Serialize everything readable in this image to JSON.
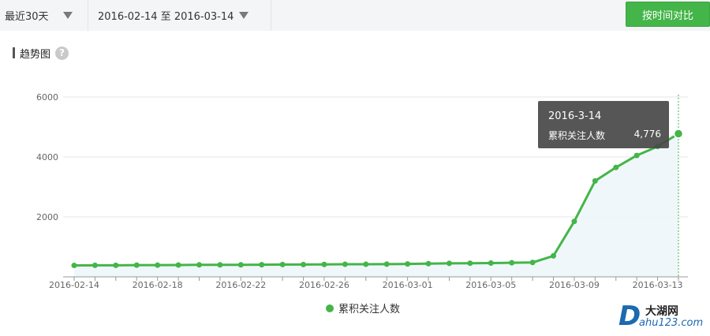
{
  "toolbar": {
    "period_label": "最近30天",
    "date_range_label": "2016-02-14 至 2016-03-14",
    "compare_button": "按时间对比"
  },
  "section": {
    "title": "趋势图",
    "help_icon": "?"
  },
  "tooltip": {
    "date": "2016-3-14",
    "series_name": "累积关注人数",
    "value_text": "4,776"
  },
  "legend": {
    "label": "累积关注人数"
  },
  "watermark": {
    "logo_letter": "D",
    "name": "大湖网",
    "url": "ahu123.com"
  },
  "colors": {
    "accent": "#44b549",
    "grid": "#e6e6e6",
    "axis": "#999999"
  },
  "chart_data": {
    "type": "line",
    "title": "",
    "xlabel": "",
    "ylabel": "",
    "ylim": [
      0,
      6000
    ],
    "yticks": [
      2000,
      4000,
      6000
    ],
    "x": [
      "2016-02-14",
      "2016-02-15",
      "2016-02-16",
      "2016-02-17",
      "2016-02-18",
      "2016-02-19",
      "2016-02-20",
      "2016-02-21",
      "2016-02-22",
      "2016-02-23",
      "2016-02-24",
      "2016-02-25",
      "2016-02-26",
      "2016-02-27",
      "2016-02-28",
      "2016-02-29",
      "2016-03-01",
      "2016-03-02",
      "2016-03-03",
      "2016-03-04",
      "2016-03-05",
      "2016-03-06",
      "2016-03-07",
      "2016-03-08",
      "2016-03-09",
      "2016-03-10",
      "2016-03-11",
      "2016-03-12",
      "2016-03-13",
      "2016-03-14"
    ],
    "xtick_labels": [
      "2016-02-14",
      "2016-02-18",
      "2016-02-22",
      "2016-02-26",
      "2016-03-01",
      "2016-03-05",
      "2016-03-09",
      "2016-03-13"
    ],
    "series": [
      {
        "name": "累积关注人数",
        "values": [
          380,
          385,
          385,
          390,
          390,
          395,
          400,
          400,
          400,
          405,
          410,
          410,
          415,
          420,
          420,
          425,
          430,
          440,
          450,
          455,
          460,
          470,
          480,
          700,
          1850,
          3200,
          3650,
          4050,
          4350,
          4776
        ]
      }
    ],
    "highlight_index": 29,
    "grid": true,
    "legend_position": "bottom"
  }
}
